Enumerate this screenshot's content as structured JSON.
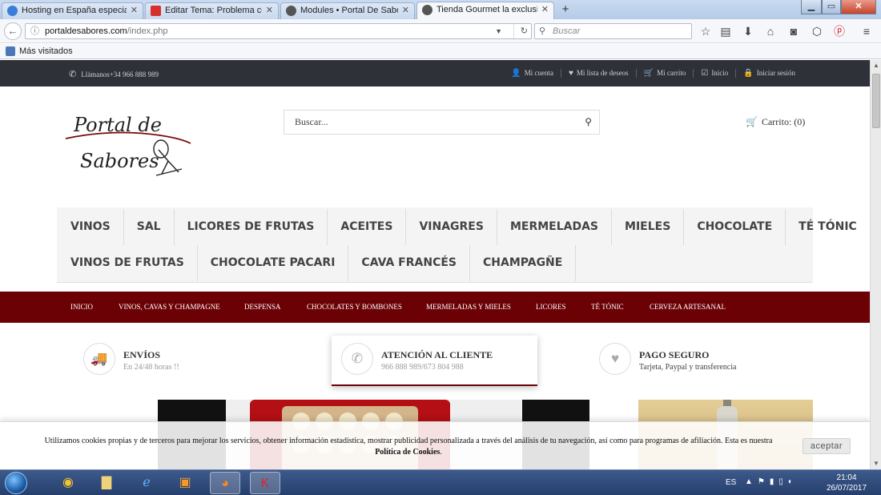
{
  "browser": {
    "tabs": [
      {
        "title": "Hosting en España especializ",
        "favicon_color": "#3b7dd8"
      },
      {
        "title": "Editar Tema: Problema con e",
        "favicon_color": "#d6302c"
      },
      {
        "title": "Modules • Portal De Sabores",
        "favicon_color": "#555555"
      },
      {
        "title": "Tienda Gourmet la exclusivid",
        "favicon_color": "#555555",
        "active": true
      }
    ],
    "new_tab": "+",
    "url_host": "portaldesabores.com",
    "url_path": "/index.php",
    "search_placeholder": "Buscar",
    "bookmarks_label": "Más visitados"
  },
  "site": {
    "phone": "Llámanos+34 966 888 989",
    "top_links": [
      {
        "label": "Mi cuenta",
        "icon": "user-icon"
      },
      {
        "label": "Mi lista de deseos",
        "icon": "heart-icon"
      },
      {
        "label": "Mi carrito",
        "icon": "cart-icon"
      },
      {
        "label": "Inicio",
        "icon": "check-icon"
      },
      {
        "label": "Iniciar sesión",
        "icon": "lock-icon"
      }
    ],
    "logo_line1": "Portal de",
    "logo_line2": "Sabores",
    "search_placeholder": "Buscar...",
    "cart_label": "Carrito: (0)",
    "categories_row1": [
      "VINOS",
      "SAL",
      "LICORES DE FRUTAS",
      "ACEITES",
      "VINAGRES",
      "MERMELADAS",
      "MIELES",
      "CHOCOLATE",
      "TÉ TÓNIC"
    ],
    "categories_row2": [
      "VINOS DE FRUTAS",
      "CHOCOLATE PACARI",
      "CAVA FRANCÉS",
      "CHAMPAGÑE"
    ],
    "main_nav": [
      "INICIO",
      "VINOS, CAVAS Y CHAMPAGNE",
      "DESPENSA",
      "CHOCOLATES Y BOMBONES",
      "MERMELADAS Y MIELES",
      "LICORES",
      "TÉ TÓNIC",
      "CERVEZA ARTESANAL"
    ],
    "features": [
      {
        "title": "ENVÍOS",
        "subtitle": "En 24/48 horas !!",
        "icon": "truck-icon"
      },
      {
        "title": "ATENCIÓN AL CLIENTE",
        "subtitle": "966 888 989/673 804 988",
        "icon": "phone-icon"
      },
      {
        "title": "PAGO SEGURO",
        "subtitle": "Tarjeta, Paypal y transferencia",
        "icon": "heart-icon"
      }
    ],
    "cookie_text": "Utilizamos cookies propias y de terceros para mejorar los servicios, obtener información estadística, mostrar publicidad personalizada a través del análisis de tu navegación, así como para programas de afiliación. Esta es nuestra",
    "cookie_policy": "Política de Cookies",
    "cookie_button": "aceptar",
    "accent_color": "#6b0105"
  },
  "taskbar": {
    "lang": "ES",
    "time": "21:04",
    "date": "26/07/2017"
  }
}
